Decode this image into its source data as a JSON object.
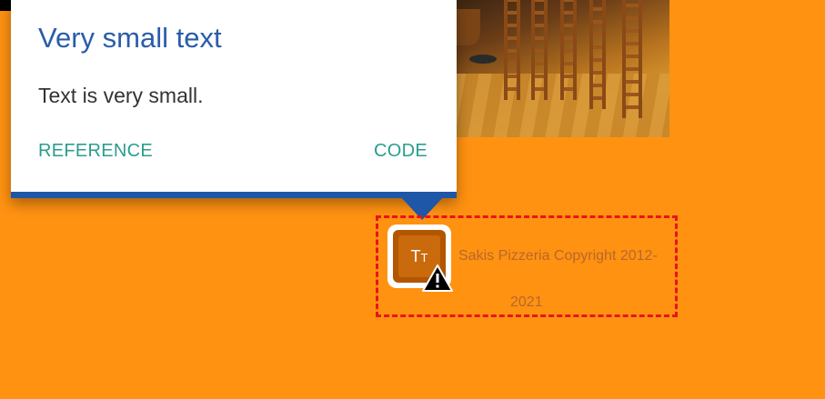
{
  "tooltip": {
    "title": "Very small text",
    "description": "Text is very small.",
    "reference_label": "REFERENCE",
    "code_label": "CODE"
  },
  "footer": {
    "copyright_line1": "Sakis Pizzeria Copyright 2012-",
    "copyright_line2": "2021"
  },
  "badge": {
    "icon": "text-size-icon",
    "glyph": "T",
    "glyph_small": "T",
    "warning_icon": "warning-icon"
  },
  "colors": {
    "page_background": "#ff9211",
    "tooltip_title": "#2a5da8",
    "tooltip_link": "#2a9d8f",
    "tooltip_border": "#1e56a8",
    "highlight_border": "#e8141c",
    "footer_text": "#b8672c"
  }
}
